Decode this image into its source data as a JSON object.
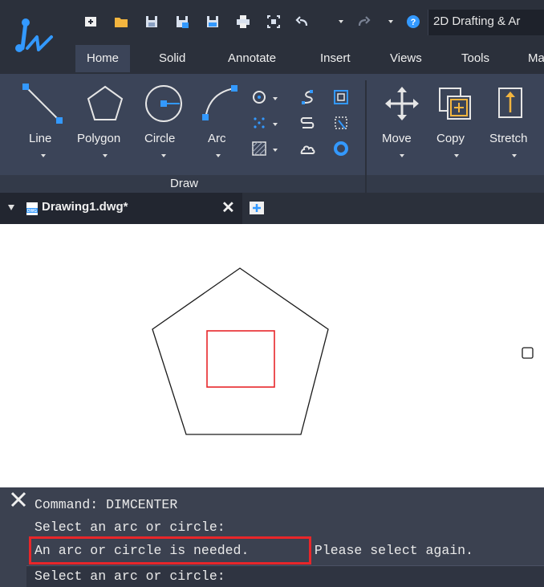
{
  "window": {
    "title": "2D Drafting & Ar"
  },
  "quick_access": {
    "icons": [
      "new-icon",
      "open-folder-icon",
      "save-icon",
      "save-as-icon",
      "save-all-icon",
      "print-icon",
      "plot-icon",
      "undo-icon",
      "redo-icon",
      "help-icon"
    ]
  },
  "ribbon": {
    "tabs": [
      {
        "label": "Home",
        "active": true
      },
      {
        "label": "Solid",
        "active": false
      },
      {
        "label": "Annotate",
        "active": false
      },
      {
        "label": "Insert",
        "active": false
      },
      {
        "label": "Views",
        "active": false
      },
      {
        "label": "Tools",
        "active": false
      },
      {
        "label": "Ma",
        "active": false
      }
    ],
    "draw_panel": {
      "title": "Draw",
      "tools": [
        {
          "label": "Line",
          "icon": "line-icon"
        },
        {
          "label": "Polygon",
          "icon": "polygon-icon"
        },
        {
          "label": "Circle",
          "icon": "circle-icon"
        },
        {
          "label": "Arc",
          "icon": "arc-icon"
        }
      ],
      "small_tools": [
        "ellipse-icon",
        "spline-icon",
        "rectangle-icon",
        "point-icon",
        "wipeout-icon",
        "boundary-icon",
        "hatch-icon",
        "cloud-icon",
        "donut-icon"
      ]
    },
    "modify_panel": {
      "tools": [
        {
          "label": "Move",
          "icon": "move-icon"
        },
        {
          "label": "Copy",
          "icon": "copy-icon"
        },
        {
          "label": "Stretch",
          "icon": "stretch-icon"
        }
      ]
    },
    "accent_color": "#3399ff"
  },
  "document": {
    "tab_title": "Drawing1.dwg*",
    "close_symbol": "✕"
  },
  "canvas": {
    "shapes": [
      "pentagon",
      "red-rectangle",
      "small-square"
    ],
    "selection_color": "#e8262a"
  },
  "command_line": {
    "lines": [
      "Command: DIMCENTER",
      "Select an arc or circle:",
      "An arc or circle is needed.",
      " Please select again.",
      "Select an arc or circle:"
    ],
    "highlight_color": "#e8262a"
  }
}
